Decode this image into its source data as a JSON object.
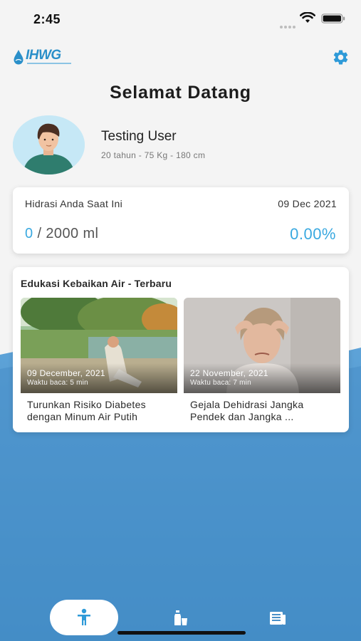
{
  "status_bar": {
    "time": "2:45",
    "icons": [
      "signal-dots-icon",
      "wifi-icon",
      "battery-icon"
    ]
  },
  "header": {
    "logo_text": "IHWG",
    "settings_icon": "gear-icon"
  },
  "page_title": "Selamat Datang",
  "profile": {
    "name": "Testing User",
    "meta": "20 tahun - 75 Kg - 180 cm"
  },
  "hydration": {
    "label": "Hidrasi Anda Saat Ini",
    "date": "09 Dec 2021",
    "current": "0",
    "target": " / 2000 ml",
    "percent": "0.00%"
  },
  "education": {
    "title": "Edukasi Kebaikan Air - Terbaru",
    "articles": [
      {
        "date": "09 December, 2021",
        "read_time": "Waktu baca: 5 min",
        "title": "Turunkan Risiko Diabetes dengan Minum Air Putih"
      },
      {
        "date": "22 November, 2021",
        "read_time": "Waktu baca: 7 min",
        "title": "Gejala Dehidrasi Jangka Pendek dan Jangka ..."
      }
    ]
  },
  "bottom_nav": {
    "items": [
      "person-icon",
      "bottle-cup-icon",
      "newspaper-icon"
    ],
    "active": 0
  },
  "colors": {
    "accent": "#3aa9e0",
    "water_light": "#5a9fd6",
    "water_deep": "#3f8cc6",
    "background": "#f4f4f4"
  }
}
